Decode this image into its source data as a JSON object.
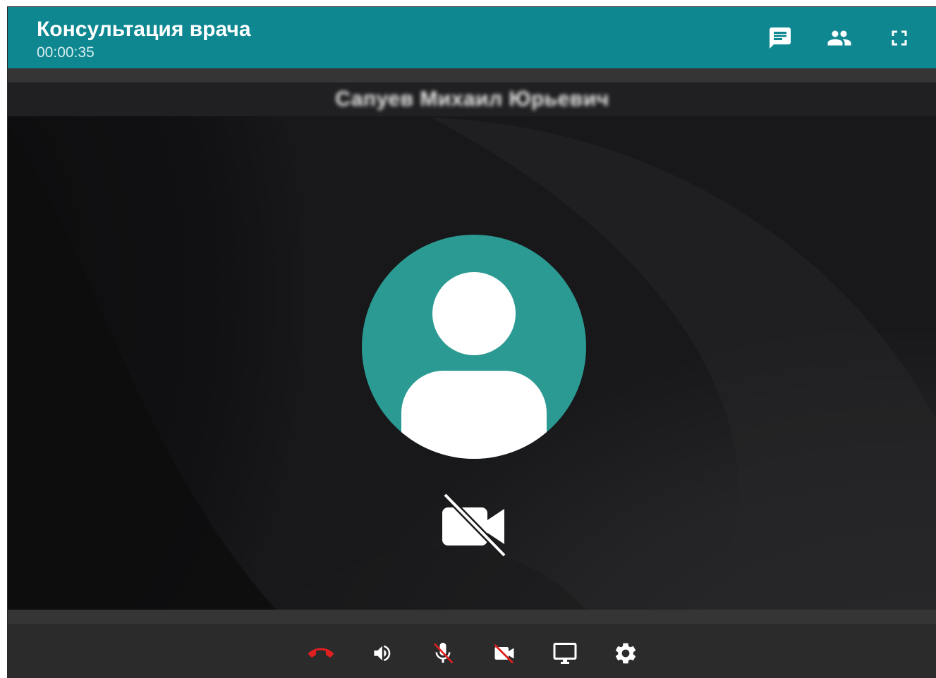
{
  "header": {
    "title": "Консультация врача",
    "timer": "00:00:35",
    "buttons": {
      "chat": "chat-icon",
      "participants": "people-icon",
      "fullscreen": "fullscreen-icon"
    }
  },
  "participant": {
    "name": "Сапуев Михаил Юрьевич",
    "camera_state": "video-off-icon"
  },
  "controls": [
    {
      "id": "hangup",
      "icon": "hangup-icon",
      "color": "#e02020"
    },
    {
      "id": "volume",
      "icon": "volume-icon",
      "color": "#ffffff"
    },
    {
      "id": "mic",
      "icon": "mic-off-icon",
      "color": "#ffffff"
    },
    {
      "id": "camera",
      "icon": "camera-off-icon",
      "color": "#ffffff"
    },
    {
      "id": "screen",
      "icon": "screen-share-icon",
      "color": "#ffffff"
    },
    {
      "id": "settings",
      "icon": "gear-icon",
      "color": "#ffffff"
    }
  ],
  "colors": {
    "header": "#0e8790",
    "avatar": "#2b9a93",
    "hangup": "#e02020",
    "disabled_slash": "#e02020"
  }
}
